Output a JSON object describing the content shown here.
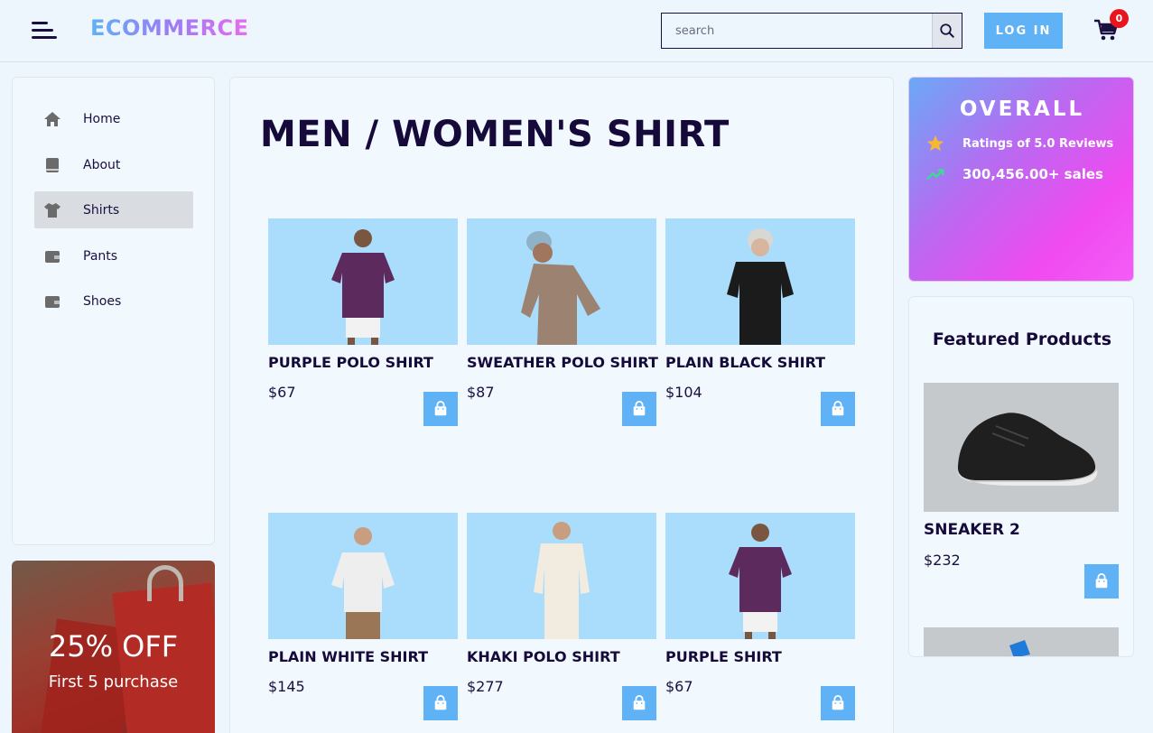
{
  "header": {
    "logo": "ECOMMERCE",
    "search_placeholder": "search",
    "search_value": "",
    "login_label": "LOG IN",
    "cart_count": "0"
  },
  "sidebar": {
    "items": [
      {
        "label": "Home",
        "icon": "home-icon"
      },
      {
        "label": "About",
        "icon": "book-icon"
      },
      {
        "label": "Shirts",
        "icon": "shirt-icon",
        "active": true
      },
      {
        "label": "Pants",
        "icon": "wallet-icon"
      },
      {
        "label": "Shoes",
        "icon": "wallet-icon"
      }
    ]
  },
  "promo": {
    "title": "25% OFF",
    "subtitle": "First 5 purchase"
  },
  "main": {
    "title": "MEN / WOMEN'S SHIRT",
    "products": [
      {
        "name": "PURPLE POLO SHIRT",
        "price": "$67"
      },
      {
        "name": "SWEATHER POLO SHIRT",
        "price": "$87"
      },
      {
        "name": "PLAIN BLACK SHIRT",
        "price": "$104"
      },
      {
        "name": "PLAIN WHITE SHIRT",
        "price": "$145"
      },
      {
        "name": "KHAKI POLO SHIRT",
        "price": "$277"
      },
      {
        "name": "PURPLE SHIRT",
        "price": "$67"
      }
    ]
  },
  "overall": {
    "title": "OVERALL",
    "rating_text": "Ratings of 5.0 Reviews",
    "sales_text": "300,456.00+ sales"
  },
  "featured": {
    "title": "Featured Products",
    "items": [
      {
        "name": "SNEAKER 2",
        "price": "$232"
      }
    ]
  },
  "colors": {
    "accent": "#5fb2f5",
    "dark_text": "#160a3a",
    "badge": "#e8151d",
    "card_bg": "#aadcfc"
  }
}
